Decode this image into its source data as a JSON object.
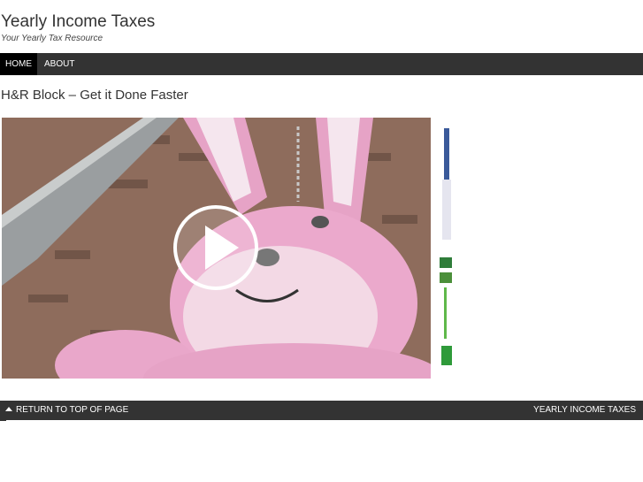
{
  "header": {
    "site_title": "Yearly Income Taxes",
    "site_description": "Your Yearly Tax Resource"
  },
  "nav": {
    "items": [
      {
        "label": "HOME",
        "active": true
      },
      {
        "label": "ABOUT",
        "active": false
      }
    ]
  },
  "post": {
    "title": "H&R Block – Get it Done Faster"
  },
  "video": {
    "play_icon": "play-icon"
  },
  "footer": {
    "back_to_top": "RETURN TO TOP OF PAGE",
    "site_link": "YEARLY INCOME TAXES"
  },
  "colors": {
    "nav_bg": "#333333",
    "nav_active": "#000000",
    "bunny_pink": "#e8a6c8"
  }
}
